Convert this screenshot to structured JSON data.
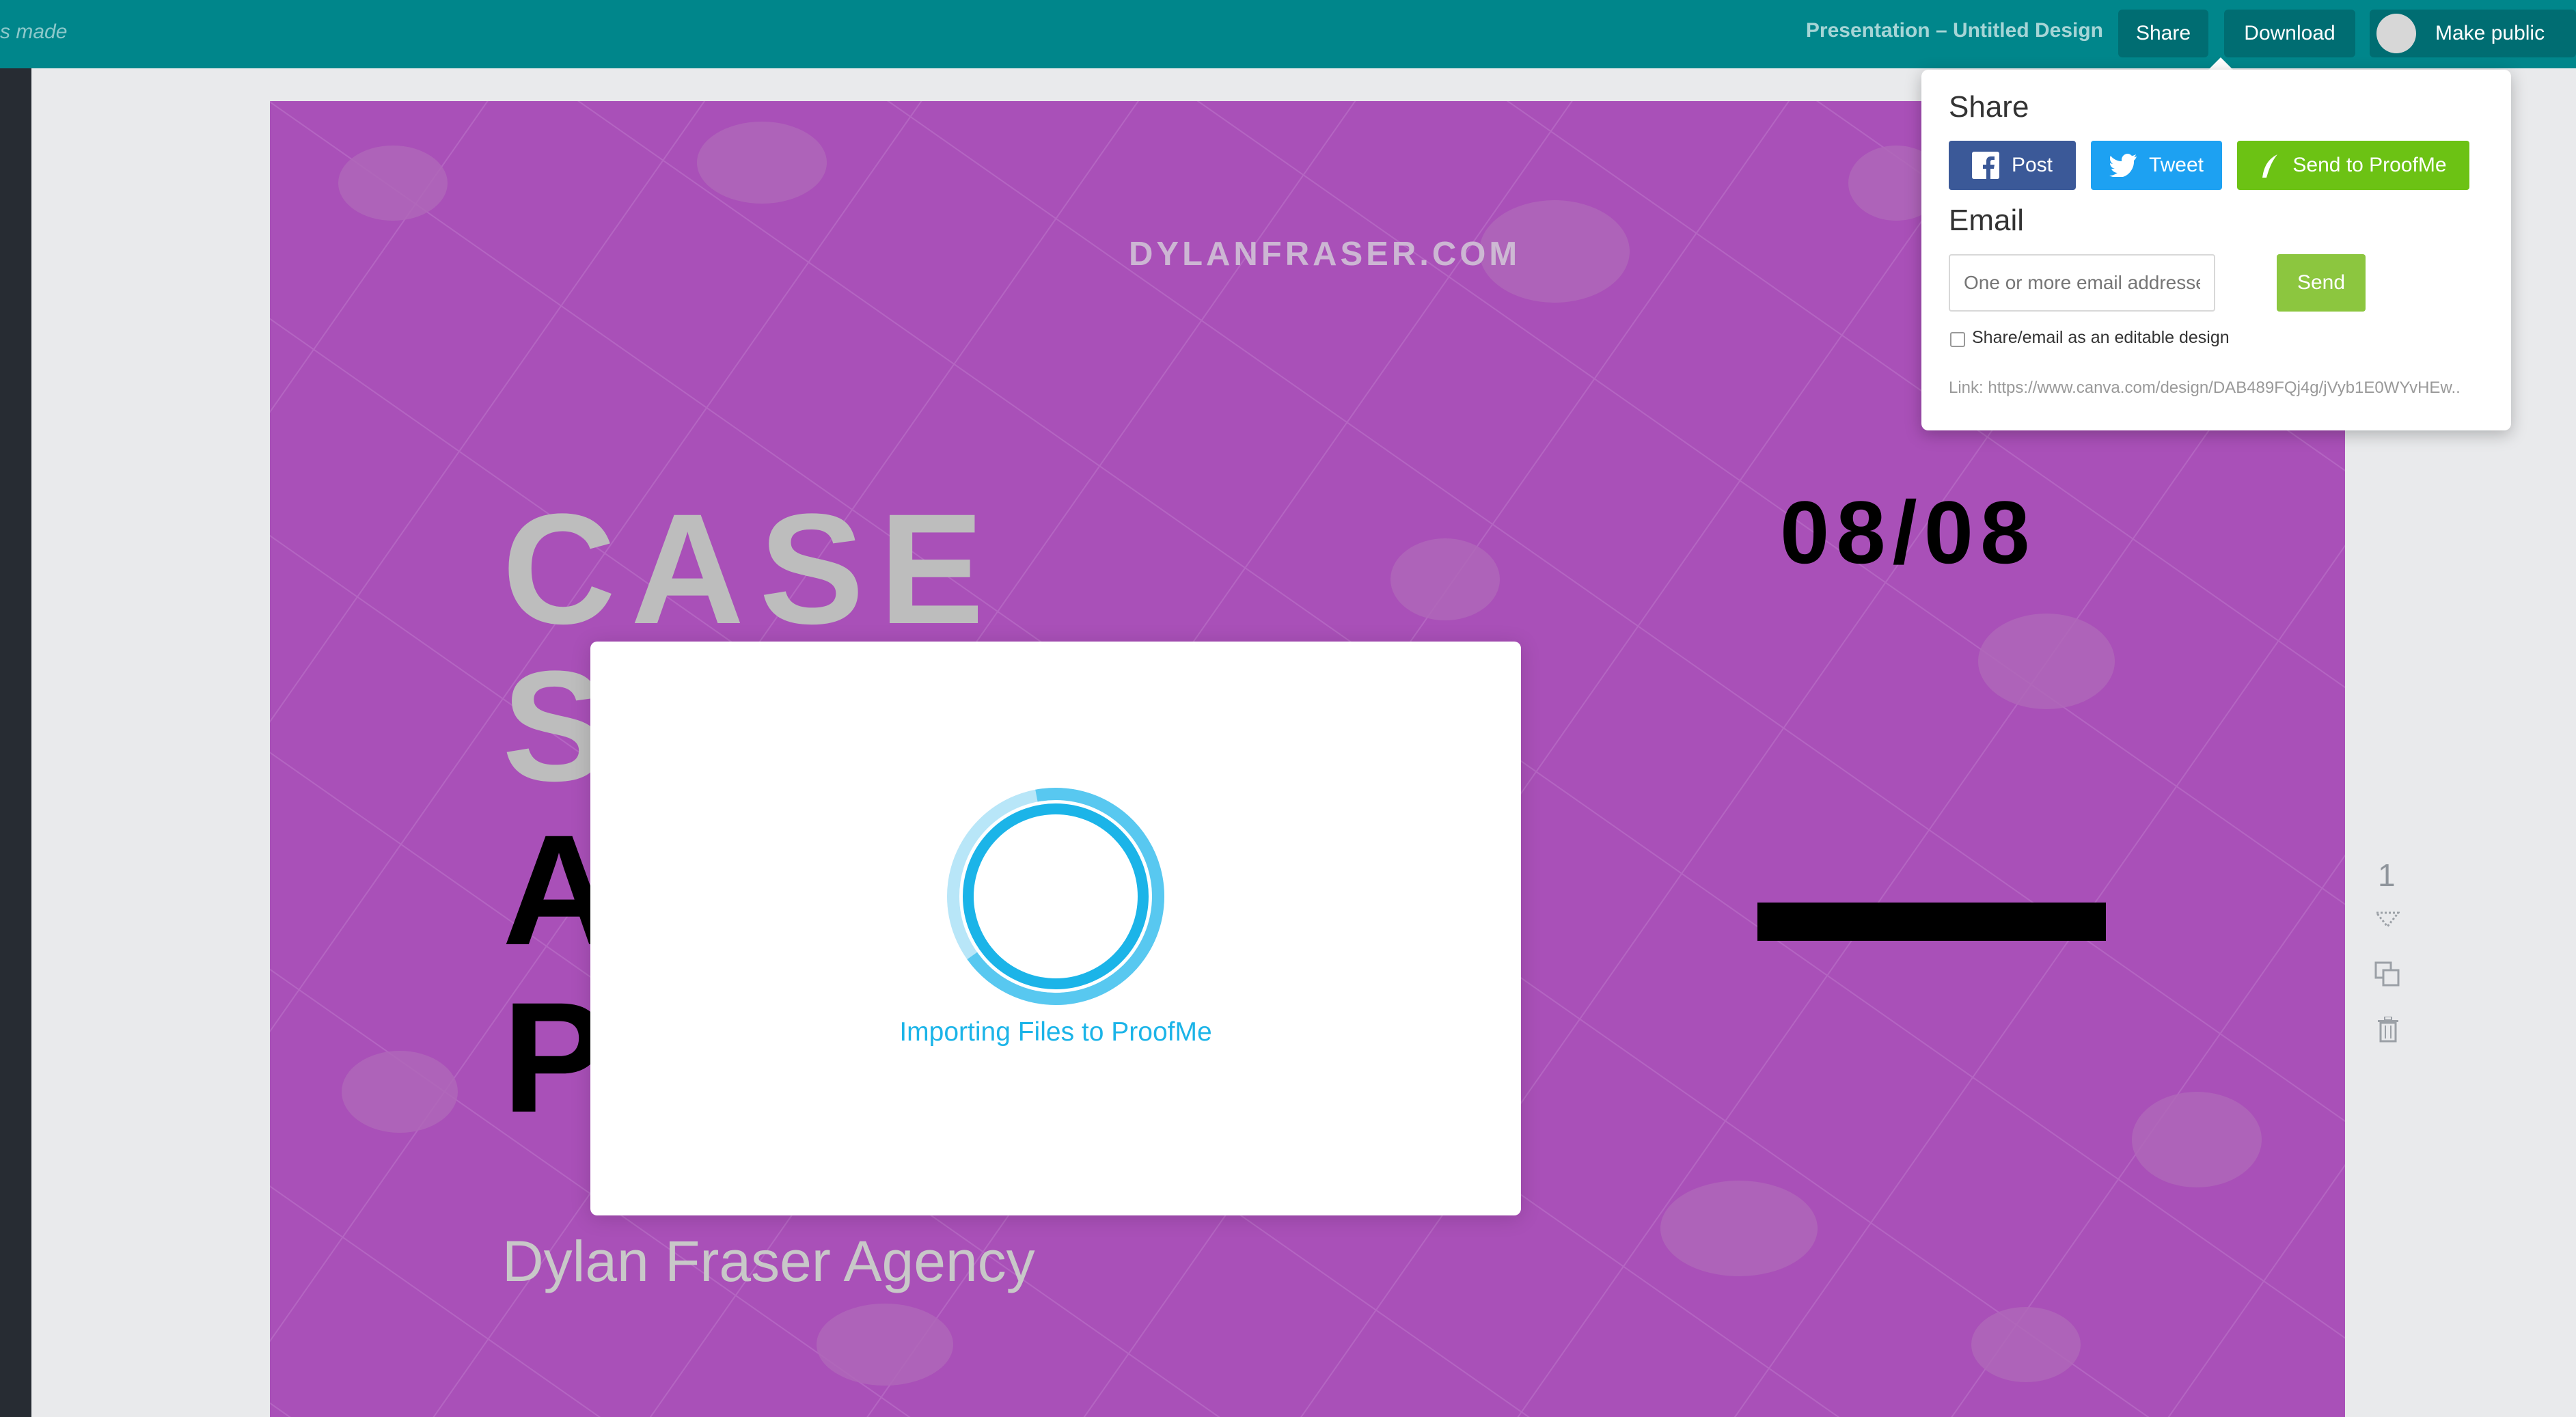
{
  "topbar": {
    "saved_status": "s made",
    "design_title": "Presentation – Untitled Design",
    "share_label": "Share",
    "download_label": "Download",
    "make_public_label": "Make public"
  },
  "canvas": {
    "website": "DYLANFRASER.COM",
    "title_line1": "CASE",
    "title_line2": "S",
    "title_line3": "A",
    "title_line4": "P",
    "agency": "Dylan Fraser Agency",
    "date": "08/08"
  },
  "page_tools": {
    "page_number": "1"
  },
  "modal": {
    "message": "Importing Files to ProofMe"
  },
  "share_popover": {
    "share_heading": "Share",
    "post_label": "Post",
    "tweet_label": "Tweet",
    "proofme_label": "Send to ProofMe",
    "email_heading": "Email",
    "email_placeholder": "One or more email addresses",
    "send_label": "Send",
    "editable_label": "Share/email as an editable design",
    "link_text": "Link:  https://www.canva.com/design/DAB489FQj4g/jVyb1E0WYvHEw.."
  },
  "colors": {
    "topbar": "#00868b",
    "canvas_bg": "#a950b8",
    "spinner": "#1bb4e8",
    "facebook": "#3b5998",
    "twitter": "#1da1f2",
    "proofme": "#6cc214",
    "send": "#8cc63f"
  }
}
